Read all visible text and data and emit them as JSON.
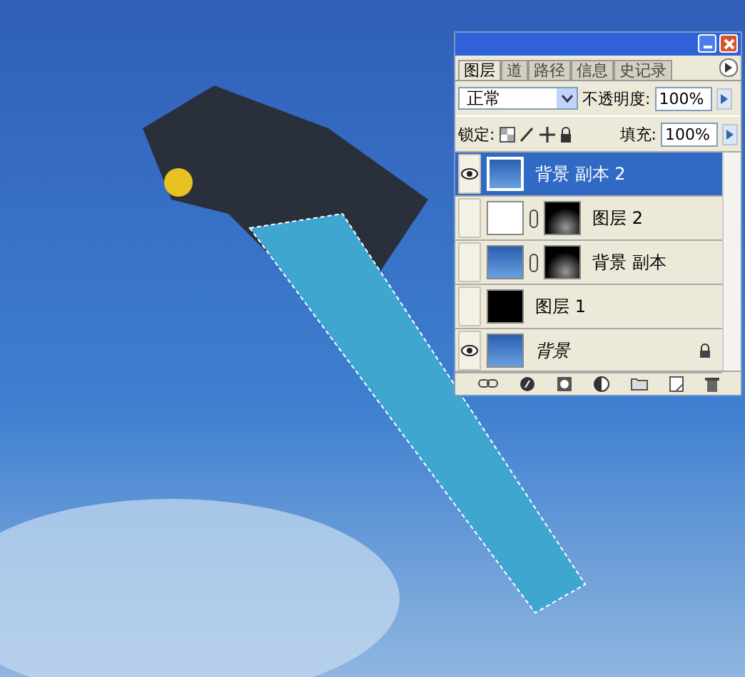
{
  "panel": {
    "tabs": [
      {
        "label": "图层",
        "selected": true
      },
      {
        "label": "道",
        "selected": false
      },
      {
        "label": "路径",
        "selected": false
      },
      {
        "label": "信息",
        "selected": false
      },
      {
        "label": "史记录",
        "selected": false
      }
    ],
    "blend_mode": "正常",
    "opacity_label": "不透明度:",
    "opacity": "100%",
    "lock_label": "锁定:",
    "fill_label": "填充:",
    "fill": "100%",
    "layers": [
      {
        "name": "背景 副本 2",
        "kind": "layer",
        "thumbnail": {
          "kind": "photo"
        },
        "mask": false,
        "visible": true,
        "selected": true,
        "locked": false
      },
      {
        "name": "图层 2",
        "kind": "layer",
        "thumbnail": {
          "kind": "white"
        },
        "mask": true,
        "visible": false,
        "selected": false,
        "locked": false
      },
      {
        "name": "背景 副本",
        "kind": "layer",
        "thumbnail": {
          "kind": "photo"
        },
        "mask": true,
        "visible": false,
        "selected": false,
        "locked": false
      },
      {
        "name": "图层 1",
        "kind": "layer",
        "thumbnail": {
          "kind": "black"
        },
        "mask": false,
        "visible": false,
        "selected": false,
        "locked": false
      },
      {
        "name": "背景",
        "kind": "background",
        "thumbnail": {
          "kind": "photo"
        },
        "mask": false,
        "visible": true,
        "selected": false,
        "locked": true
      }
    ]
  }
}
